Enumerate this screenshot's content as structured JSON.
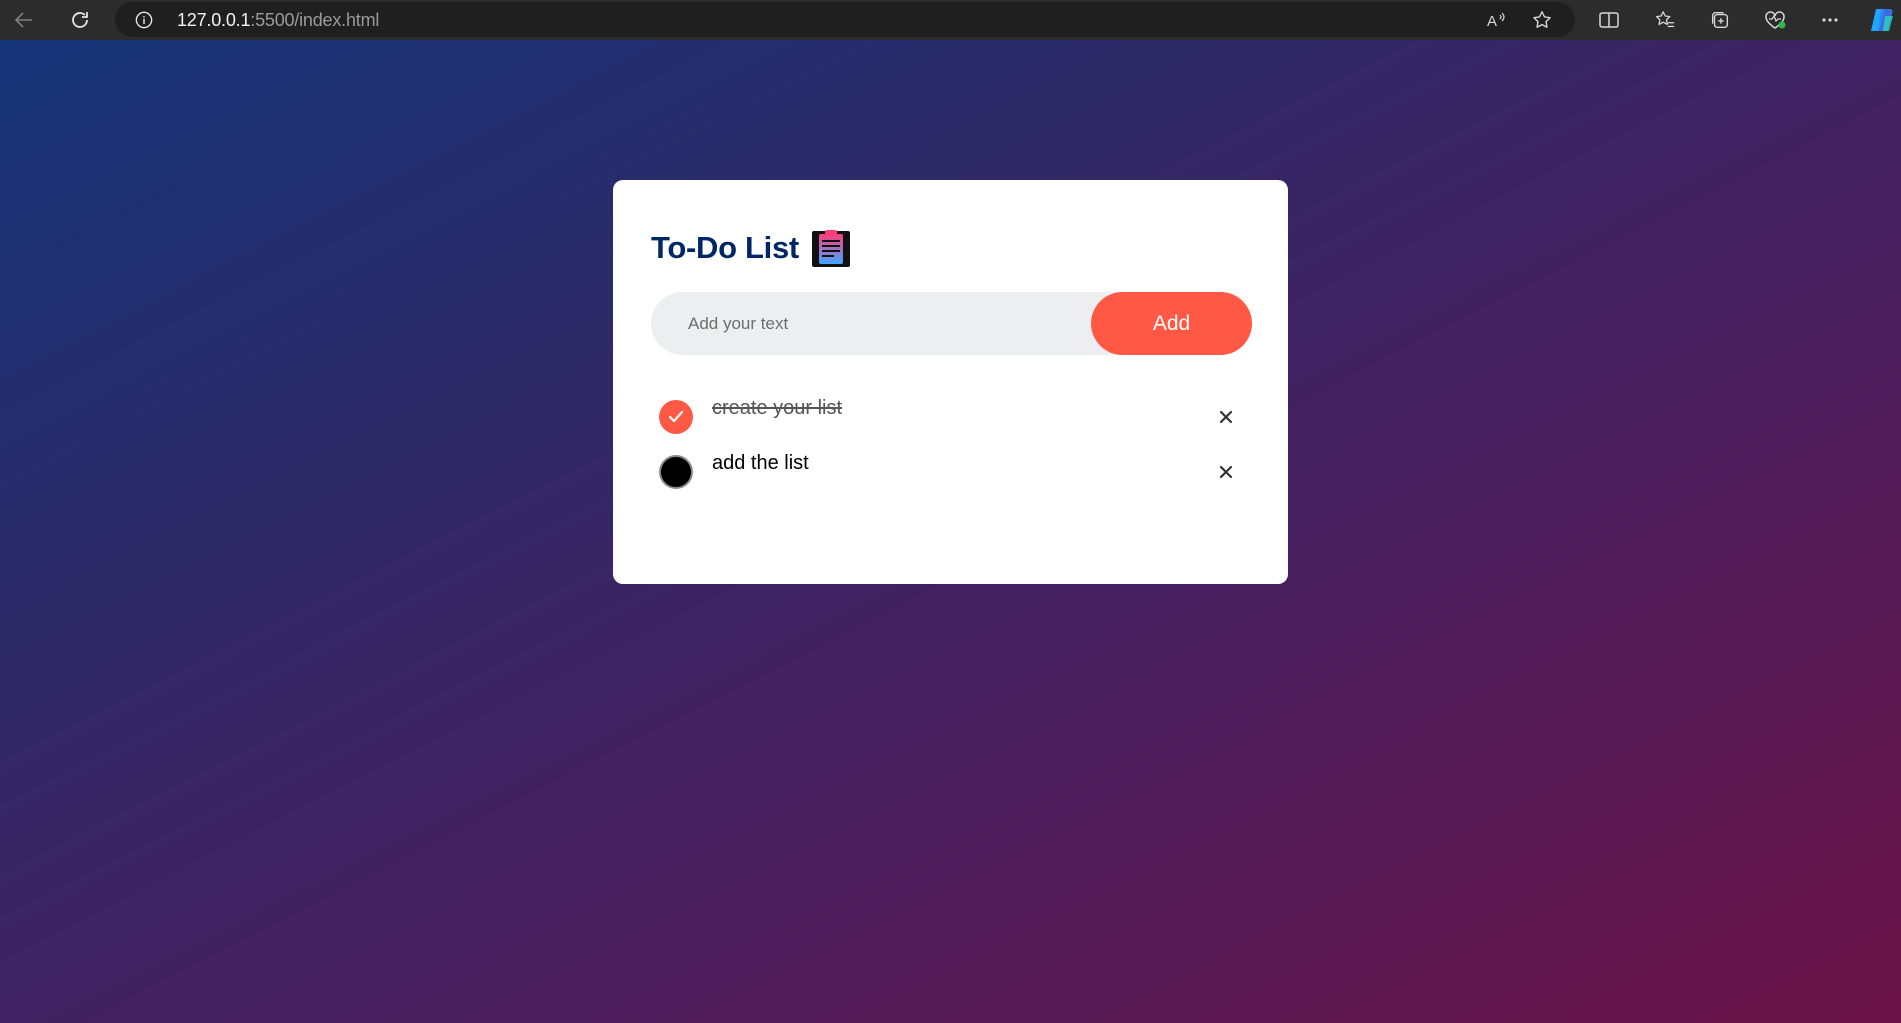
{
  "browser": {
    "url_host": "127.0.0.1",
    "url_path": ":5500/index.html",
    "icons": [
      "back-icon",
      "reload-icon",
      "info-icon",
      "read-aloud-icon",
      "favorite-star-icon",
      "split-screen-icon",
      "favorites-icon",
      "collections-icon",
      "browser-essentials-icon",
      "more-icon",
      "copilot-icon"
    ]
  },
  "app": {
    "title": "To-Do List",
    "title_icon": "notepad-icon",
    "input_placeholder": "Add your text",
    "add_label": "Add",
    "accent_color": "#ff5945",
    "title_color": "#002765"
  },
  "todos": [
    {
      "text": "create your list",
      "checked": true
    },
    {
      "text": "add the list",
      "checked": false
    }
  ]
}
